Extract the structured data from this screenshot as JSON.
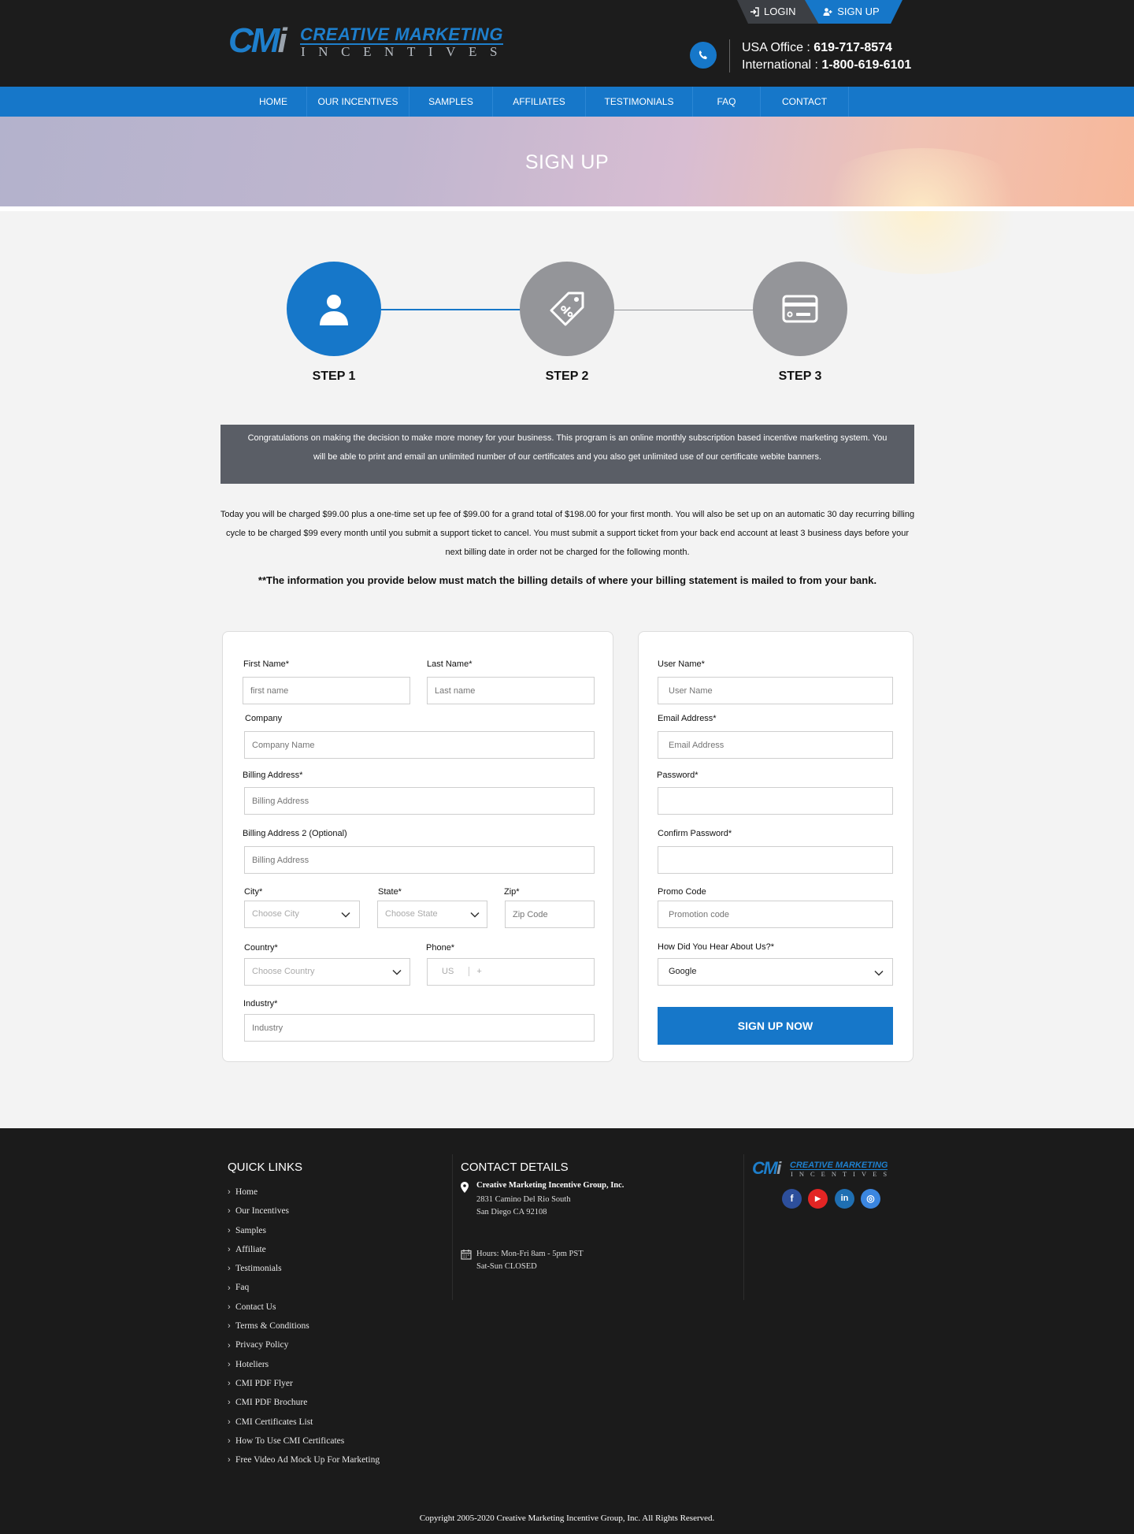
{
  "header": {
    "logo": {
      "mark": "CMi",
      "line1": "CREATIVE MARKETING",
      "line2": "INCENTIVES"
    },
    "auth": {
      "login_label": "LOGIN",
      "signup_label": "SIGN UP"
    },
    "contact": {
      "usa_label": "USA Office : ",
      "usa_phone": "619-717-8574",
      "intl_label": "International : ",
      "intl_phone": "1-800-619-6101"
    }
  },
  "nav": {
    "items": [
      "HOME",
      "OUR INCENTIVES",
      "SAMPLES",
      "AFFILIATES",
      "TESTIMONIALS",
      "FAQ",
      "CONTACT"
    ]
  },
  "banner": {
    "title": "SIGN UP"
  },
  "steps": {
    "items": [
      {
        "label": "STEP 1",
        "icon": "user-icon",
        "active": true
      },
      {
        "label": "STEP 2",
        "icon": "tag-icon",
        "active": false
      },
      {
        "label": "STEP 3",
        "icon": "credit-card-icon",
        "active": false
      }
    ],
    "active_color": "#1677c9",
    "inactive_color": "#949599"
  },
  "intro": {
    "box_text": "Congratulations on making the decision to make more money for your business. This program is an online monthly subscription based incentive marketing system. You will be able to print and email an unlimited number of our certificates and you also get unlimited use of our certificate webite banners.",
    "charge_text": "Today you will be charged $99.00 plus a one-time set up fee of $99.00 for a grand total of $198.00 for your first month. You will also be set up on an automatic 30 day recurring billing cycle to be charged $99 every month until you submit a support ticket to cancel. You must submit a support ticket from your back end account at least 3 business days before your next billing date in order not be charged for the following month.",
    "billing_note": "**The information you provide below must match the billing details of where your billing statement is mailed to from your bank."
  },
  "form_left": {
    "first_name": {
      "label": "First Name*",
      "placeholder": "first name"
    },
    "last_name": {
      "label": "Last Name*",
      "placeholder": "Last name"
    },
    "company": {
      "label": "Company",
      "placeholder": "Company Name"
    },
    "billing1": {
      "label": "Billing Address*",
      "placeholder": "Billing Address"
    },
    "billing2": {
      "label": "Billing Address 2 (Optional)",
      "placeholder": "Billing Address"
    },
    "city": {
      "label": "City*",
      "value": "Choose City"
    },
    "state": {
      "label": "State*",
      "value": "Choose State"
    },
    "zip": {
      "label": "Zip*",
      "placeholder": "Zip Code"
    },
    "country": {
      "label": "Country*",
      "value": "Choose Country"
    },
    "phone": {
      "label": "Phone*",
      "country_code": "US",
      "prefix": "+"
    },
    "industry": {
      "label": "Industry*",
      "placeholder": "Industry"
    }
  },
  "form_right": {
    "username": {
      "label": "User Name*",
      "placeholder": "User Name"
    },
    "email": {
      "label": "Email Address*",
      "placeholder": "Email Address"
    },
    "password": {
      "label": "Password*",
      "placeholder": ""
    },
    "confirm_password": {
      "label": "Confirm Password*",
      "placeholder": ""
    },
    "promo": {
      "label": "Promo Code",
      "placeholder": "Promotion code"
    },
    "heard": {
      "label": "How Did You Hear About Us?*",
      "value": "Google"
    },
    "submit_label": "SIGN UP NOW"
  },
  "footer": {
    "quick_links_title": "QUICK LINKS",
    "quick_links": [
      "Home",
      "Our Incentives",
      "Samples",
      "Affiliate",
      "Testimonials",
      "Faq",
      "Contact Us",
      "Terms & Conditions",
      "Privacy Policy",
      "Hoteliers",
      "CMI PDF Flyer",
      "CMI PDF Brochure",
      "CMI Certificates List",
      "How To Use CMI Certificates",
      "Free Video Ad Mock Up For Marketing"
    ],
    "contact_title": "CONTACT DETAILS",
    "company": "Creative Marketing Incentive Group, Inc.",
    "address1": "2831 Camino Del Rio South",
    "address2": "San Diego CA 92108",
    "hours1": "Hours: Mon-Fri 8am - 5pm PST",
    "hours2": "Sat-Sun CLOSED",
    "social": [
      {
        "name": "facebook-icon",
        "glyph": "f",
        "color": "#2d4f9c"
      },
      {
        "name": "youtube-icon",
        "glyph": "▶",
        "color": "#e32524"
      },
      {
        "name": "linkedin-icon",
        "glyph": "in",
        "color": "#1f6fb2"
      },
      {
        "name": "instagram-icon",
        "glyph": "◎",
        "color": "#3b86e0"
      }
    ],
    "copyright": "Copyright 2005-2020 Creative Marketing Incentive Group, Inc. All Rights Reserved."
  }
}
